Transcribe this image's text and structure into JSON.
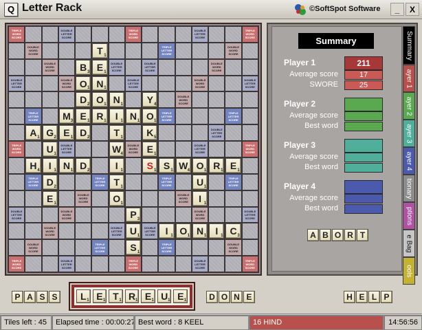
{
  "window": {
    "title": "Letter Rack",
    "app_icon_letter": "Q",
    "brand": "©SoftSpot Software",
    "minimize": "_",
    "close": "X"
  },
  "bonus_labels": {
    "TW": "TRIPLE WORD SCORE",
    "DW": "DOUBLE WORD SCORE",
    "TL": "TRIPLE LETTER SCORE",
    "DL": "DOUBLE LETTER SCORE"
  },
  "board": {
    "bonus_layout": [
      "T..d...T...d..T",
      ".D...t...t...D.",
      "..D...d.d...D..",
      "d..D...d...D..d",
      "....D.....D....",
      ".t...t...t...t.",
      "..d...d.d...d..",
      "T..d...D...d..T",
      "..d...d.d...d..",
      ".t...t...t...t.",
      "....D.....D....",
      "d..D...d...D..d",
      "..D...d.d...D..",
      ".D...t...t...D.",
      "T..d...T...d..T"
    ],
    "tiles": [
      {
        "r": 1,
        "c": 5,
        "ch": "T",
        "sc": "1"
      },
      {
        "r": 2,
        "c": 4,
        "ch": "B",
        "sc": "3"
      },
      {
        "r": 2,
        "c": 5,
        "ch": "E",
        "sc": "1"
      },
      {
        "r": 3,
        "c": 4,
        "ch": "O",
        "sc": "1"
      },
      {
        "r": 3,
        "c": 5,
        "ch": "N",
        "sc": "1"
      },
      {
        "r": 4,
        "c": 4,
        "ch": "D",
        "sc": "2"
      },
      {
        "r": 4,
        "c": 5,
        "ch": "O",
        "sc": "1"
      },
      {
        "r": 4,
        "c": 6,
        "ch": "N",
        "sc": "1"
      },
      {
        "r": 4,
        "c": 8,
        "ch": "Y",
        "sc": "4"
      },
      {
        "r": 5,
        "c": 3,
        "ch": "M",
        "sc": "3"
      },
      {
        "r": 5,
        "c": 4,
        "ch": "E",
        "sc": "1"
      },
      {
        "r": 5,
        "c": 5,
        "ch": "R",
        "sc": "1"
      },
      {
        "r": 5,
        "c": 6,
        "ch": "I",
        "sc": "1"
      },
      {
        "r": 5,
        "c": 7,
        "ch": "N",
        "sc": "1"
      },
      {
        "r": 5,
        "c": 8,
        "ch": "O",
        "sc": "1"
      },
      {
        "r": 6,
        "c": 1,
        "ch": "A",
        "sc": "1"
      },
      {
        "r": 6,
        "c": 2,
        "ch": "G",
        "sc": "2"
      },
      {
        "r": 6,
        "c": 3,
        "ch": "E",
        "sc": "1"
      },
      {
        "r": 6,
        "c": 4,
        "ch": "D",
        "sc": "2"
      },
      {
        "r": 6,
        "c": 6,
        "ch": "T",
        "sc": "1"
      },
      {
        "r": 6,
        "c": 8,
        "ch": "K",
        "sc": "5"
      },
      {
        "r": 7,
        "c": 2,
        "ch": "U",
        "sc": "1"
      },
      {
        "r": 7,
        "c": 6,
        "ch": "W",
        "sc": "4"
      },
      {
        "r": 7,
        "c": 8,
        "ch": "E",
        "sc": "1"
      },
      {
        "r": 8,
        "c": 1,
        "ch": "H",
        "sc": "4"
      },
      {
        "r": 8,
        "c": 2,
        "ch": "I",
        "sc": "1"
      },
      {
        "r": 8,
        "c": 3,
        "ch": "N",
        "sc": "1"
      },
      {
        "r": 8,
        "c": 4,
        "ch": "D",
        "sc": "2"
      },
      {
        "r": 8,
        "c": 6,
        "ch": "I",
        "sc": "1"
      },
      {
        "r": 8,
        "c": 8,
        "ch": "S",
        "sc": "1",
        "red": true
      },
      {
        "r": 8,
        "c": 9,
        "ch": "S",
        "sc": "1"
      },
      {
        "r": 8,
        "c": 10,
        "ch": "W",
        "sc": "4"
      },
      {
        "r": 8,
        "c": 11,
        "ch": "O",
        "sc": "1"
      },
      {
        "r": 8,
        "c": 12,
        "ch": "R",
        "sc": "1"
      },
      {
        "r": 8,
        "c": 13,
        "ch": "E",
        "sc": "1"
      },
      {
        "r": 9,
        "c": 2,
        "ch": "D",
        "sc": "2"
      },
      {
        "r": 9,
        "c": 6,
        "ch": "T",
        "sc": "1"
      },
      {
        "r": 9,
        "c": 11,
        "ch": "U",
        "sc": "1"
      },
      {
        "r": 10,
        "c": 2,
        "ch": "E",
        "sc": "1"
      },
      {
        "r": 10,
        "c": 6,
        "ch": "O",
        "sc": "1"
      },
      {
        "r": 10,
        "c": 11,
        "ch": "I",
        "sc": "1"
      },
      {
        "r": 11,
        "c": 7,
        "ch": "P",
        "sc": "3"
      },
      {
        "r": 12,
        "c": 7,
        "ch": "U",
        "sc": "1"
      },
      {
        "r": 12,
        "c": 9,
        "ch": "I",
        "sc": "1"
      },
      {
        "r": 12,
        "c": 10,
        "ch": "O",
        "sc": "1"
      },
      {
        "r": 12,
        "c": 11,
        "ch": "N",
        "sc": "1"
      },
      {
        "r": 12,
        "c": 12,
        "ch": "I",
        "sc": "1"
      },
      {
        "r": 12,
        "c": 13,
        "ch": "C",
        "sc": "3"
      },
      {
        "r": 13,
        "c": 7,
        "ch": "S",
        "sc": "1"
      }
    ]
  },
  "summary": {
    "title": "Summary",
    "players": [
      {
        "name": "Player 1",
        "score": "211",
        "avg_label": "Average score",
        "avg": "17",
        "word_label": "SWORE",
        "word": "25",
        "color": "#c95a55",
        "score_bg": "#a83838",
        "fg": "#ffffff"
      },
      {
        "name": "Player 2",
        "score": "",
        "avg_label": "Average score",
        "avg": "",
        "word_label": "Best word",
        "word": "",
        "color": "#5aa84f",
        "score_bg": "#5aa84f",
        "fg": "#ffffff"
      },
      {
        "name": "Player 3",
        "score": "",
        "avg_label": "Average score",
        "avg": "",
        "word_label": "Best word",
        "word": "",
        "color": "#4faf9b",
        "score_bg": "#4faf9b",
        "fg": "#ffffff"
      },
      {
        "name": "Player 4",
        "score": "",
        "avg_label": "Average score",
        "avg": "",
        "word_label": "Best word",
        "word": "",
        "color": "#4b5aac",
        "score_bg": "#4b5aac",
        "fg": "#ffffff"
      }
    ],
    "abort_letters": [
      "A",
      "B",
      "O",
      "R",
      "T"
    ]
  },
  "tabs": [
    {
      "label": "Summary",
      "color": "#000000"
    },
    {
      "label": "ayer 1",
      "color": "#b7504c"
    },
    {
      "label": "ayer 2",
      "color": "#5aa84f"
    },
    {
      "label": "ayer 3",
      "color": "#4faf9b"
    },
    {
      "label": "ayer 4",
      "color": "#4b5aac"
    },
    {
      "label": "tionary",
      "color": "#8c8c8c"
    },
    {
      "label": "ptions",
      "color": "#b052a3"
    },
    {
      "label": "e Bag",
      "color": "#c6c6c6"
    },
    {
      "label": "ools",
      "color": "#c4b232"
    }
  ],
  "controls": {
    "pass": [
      "P",
      "A",
      "S",
      "S"
    ],
    "done": [
      "D",
      "O",
      "N",
      "E"
    ],
    "help": [
      "H",
      "E",
      "L",
      "P"
    ],
    "rack": [
      {
        "ch": "L",
        "sc": "1"
      },
      {
        "ch": "E",
        "sc": "1"
      },
      {
        "ch": "T",
        "sc": "1"
      },
      {
        "ch": "R",
        "sc": "1"
      },
      {
        "ch": "E",
        "sc": "1"
      },
      {
        "ch": "U",
        "sc": "1"
      },
      {
        "ch": "E",
        "sc": "1"
      }
    ]
  },
  "status": {
    "tiles_left": "Tiles left : 45",
    "elapsed": "Elapsed time : 00:00:27",
    "best_word": "Best word : 8 KEEL",
    "last_move": "16  HIND",
    "clock": "14:56:56"
  }
}
